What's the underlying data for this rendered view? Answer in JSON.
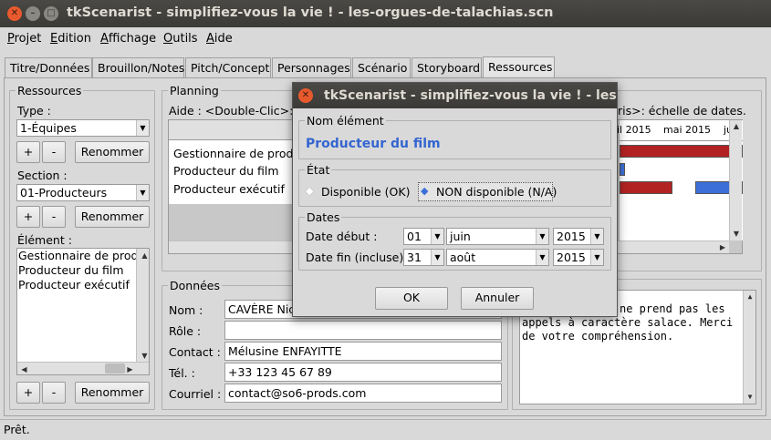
{
  "window": {
    "title": "tkScenarist - simplifiez-vous la vie ! - les-orgues-de-talachias.scn"
  },
  "menu": [
    {
      "label": "Projet",
      "u": "P",
      "rest": "rojet"
    },
    {
      "label": "Edition",
      "u": "E",
      "rest": "dition"
    },
    {
      "label": "Affichage",
      "u": "A",
      "rest": "ffichage"
    },
    {
      "label": "Outils",
      "u": "O",
      "rest": "utils"
    },
    {
      "label": "Aide",
      "u": "A",
      "rest": "ide"
    }
  ],
  "tabs": [
    "Titre/Données",
    "Brouillon/Notes",
    "Pitch/Concept",
    "Personnages",
    "Scénario",
    "Storyboard",
    "Ressources"
  ],
  "ressources": {
    "legend": "Ressources",
    "type_label": "Type :",
    "type_value": "1-Équipes",
    "section_label": "Section :",
    "section_value": "01-Producteurs",
    "element_label": "Élément :",
    "elements": [
      "Gestionnaire de produ",
      "Producteur du film",
      "Producteur exécutif"
    ],
    "plus": "+",
    "minus": "-",
    "rename": "Renommer"
  },
  "planning": {
    "legend": "Planning",
    "help_left": "Aide : <Double-Clic>:",
    "help_right": "ris>: échelle de dates.",
    "rows": [
      "Gestionnaire de produ",
      "Producteur du film",
      "Producteur exécutif"
    ],
    "months": [
      "il 2015",
      "mai 2015",
      "juin"
    ]
  },
  "donnees": {
    "legend": "Données",
    "nom_label": "Nom :",
    "nom_value": "CAVÈRE Nic",
    "role_label": "Rôle :",
    "role_value": "",
    "contact_label": "Contact :",
    "contact_value": "Mélusine ENFAYITTE",
    "tel_label": "Tél. :",
    "tel_value": "+33 123 45 67 89",
    "courriel_label": "Courriel :",
    "courriel_value": "contact@so6-prods.com",
    "notes": [
      "ne prend pas les",
      "appels à caractère salace. Merci",
      "de votre compréhension."
    ]
  },
  "status": "Prêt.",
  "dialog": {
    "title": "tkScenarist - simplifiez-vous la vie ! - les-org",
    "nom_legend": "Nom élément",
    "nom_value": "Producteur du film",
    "etat_legend": "État",
    "opt1": "Disponible (OK)",
    "opt2": "NON disponible (N/A)",
    "dates_legend": "Dates",
    "debut_label": "Date début :",
    "debut_day": "01",
    "debut_month": "juin",
    "debut_year": "2015",
    "fin_label": "Date fin (incluse):",
    "fin_day": "31",
    "fin_month": "août",
    "fin_year": "2015",
    "ok": "OK",
    "cancel": "Annuler"
  },
  "colors": {
    "title_blue": "#3465d0",
    "bar_red": "#b22222",
    "bar_blue": "#3c6fd8"
  }
}
